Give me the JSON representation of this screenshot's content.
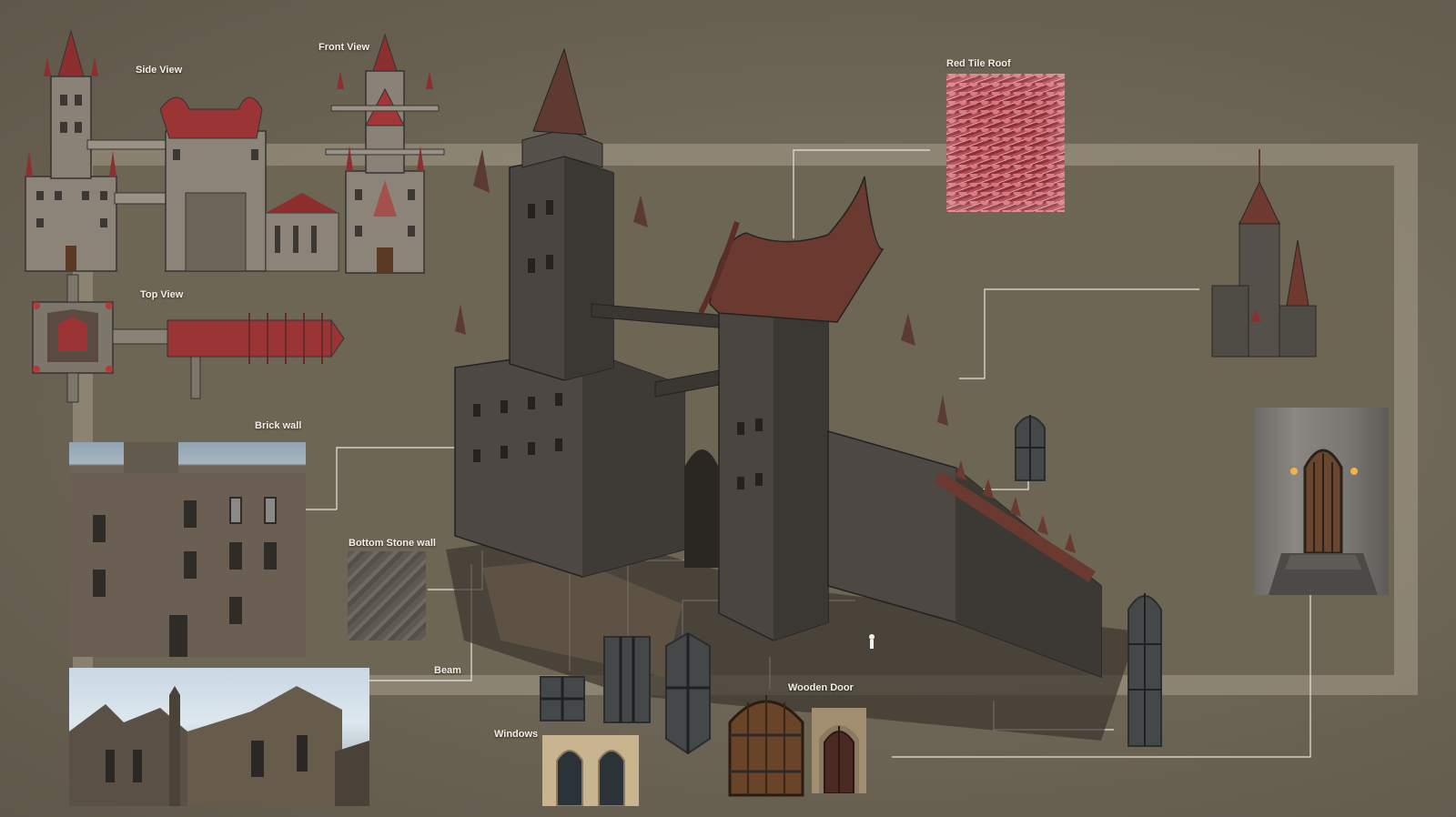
{
  "labels": {
    "side_view": "Side View",
    "front_view": "Front View",
    "top_view": "Top View",
    "red_tile_roof": "Red Tile Roof",
    "brick_wall": "Brick wall",
    "bottom_stone_wall": "Bottom Stone wall",
    "beam": "Beam",
    "windows": "Windows",
    "wooden_door": "Wooden Door"
  },
  "colors": {
    "background": "#6f6757",
    "frame": "#a79f8c",
    "stone": "#4a4640",
    "roof": "#7a3a30",
    "accent_red": "#b13a3a",
    "leader_line": "#e8e4dc"
  }
}
